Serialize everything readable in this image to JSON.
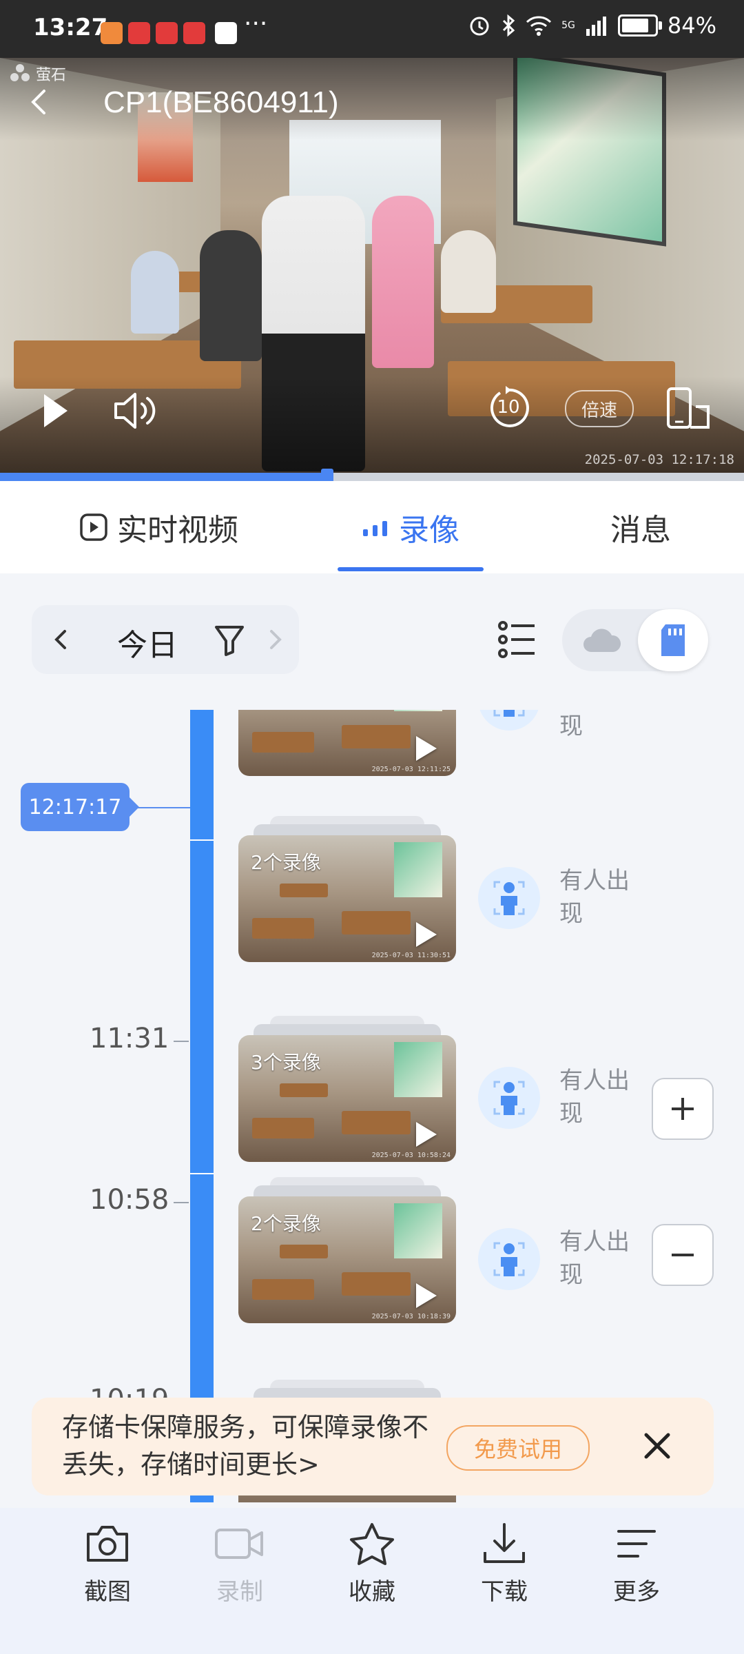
{
  "status_bar": {
    "time": "13:27",
    "more_icons": "···",
    "battery": "84%",
    "network": "5G"
  },
  "player": {
    "brand": "萤石",
    "title": "CP1(BE8604911)",
    "speed_label": "倍速",
    "replay_seconds": "10",
    "timestamp": "2025-07-03 12:17:18",
    "progress": 0.44
  },
  "tabs": [
    {
      "label": "实时视频",
      "icon": "play-icon"
    },
    {
      "label": "录像",
      "icon": "signal-bars-icon"
    },
    {
      "label": "消息"
    }
  ],
  "filter": {
    "day": "今日"
  },
  "timeline": {
    "cursor_time": "12:17:17",
    "time_labels": [
      "11:31",
      "10:58",
      "10:19"
    ],
    "events": [
      {
        "count": "",
        "event_text": "现",
        "thumb_ts": "2025-07-03 12:11:25"
      },
      {
        "count": "2个录像",
        "event_text": "有人出现",
        "thumb_ts": "2025-07-03 11:30:51"
      },
      {
        "count": "3个录像",
        "event_text": "有人出现",
        "thumb_ts": "2025-07-03 10:58:24"
      },
      {
        "count": "2个录像",
        "event_text": "有人出现",
        "thumb_ts": "2025-07-03 10:18:39"
      }
    ]
  },
  "banner": {
    "text": "存储卡保障服务，可保障录像不丢失，存储时间更长>",
    "trial_label": "免费试用"
  },
  "bottom_bar": [
    {
      "label": "截图",
      "icon": "camera-icon",
      "enabled": true
    },
    {
      "label": "录制",
      "icon": "video-record-icon",
      "enabled": false
    },
    {
      "label": "收藏",
      "icon": "star-icon",
      "enabled": true
    },
    {
      "label": "下载",
      "icon": "download-icon",
      "enabled": true
    },
    {
      "label": "更多",
      "icon": "more-menu-icon",
      "enabled": true
    }
  ],
  "colors": {
    "accent": "#3a75f0",
    "timeline_bar": "#3a8cf6",
    "banner_bg": "#fdf0e4",
    "trial": "#f29a4c"
  }
}
